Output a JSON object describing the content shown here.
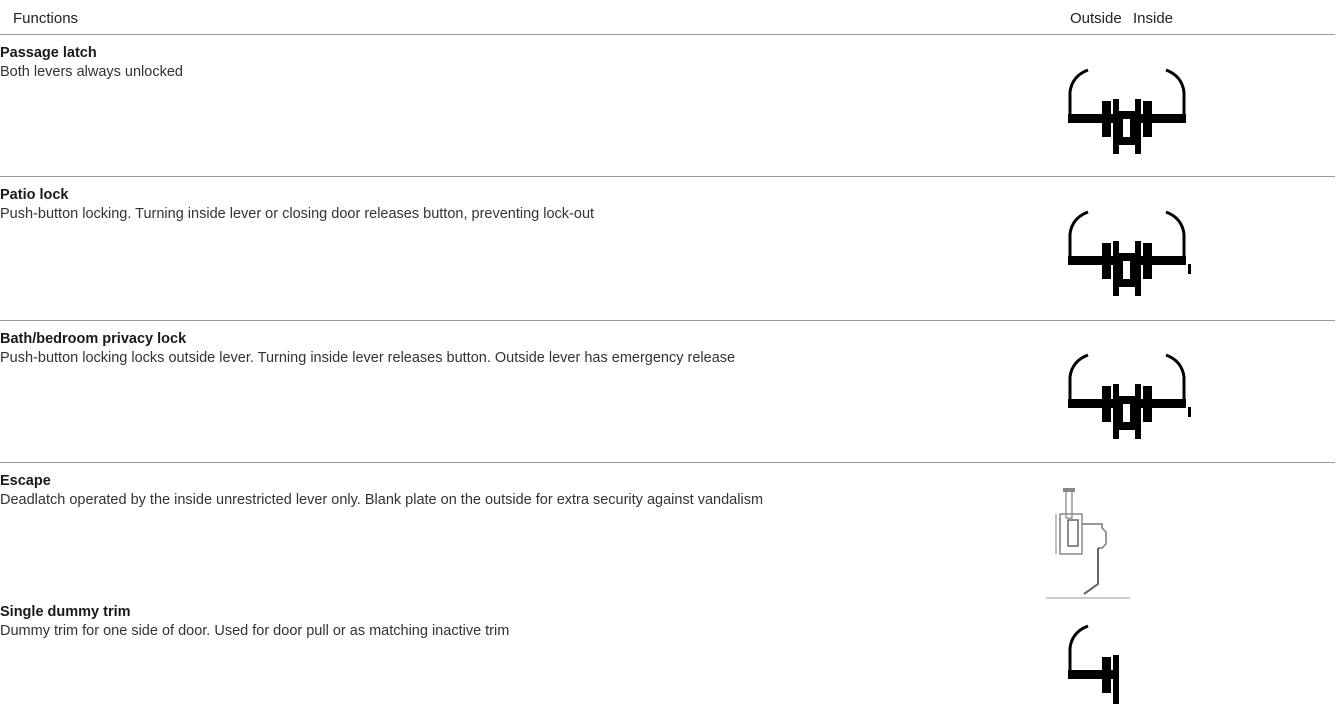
{
  "header": {
    "functions_label": "Functions",
    "outside_label": "Outside",
    "inside_label": "Inside"
  },
  "rows": [
    {
      "title": "Passage latch",
      "description": "Both levers always unlocked",
      "icon": "double-lever-icon"
    },
    {
      "title": "Patio lock",
      "description": "Push-button locking. Turning inside lever or closing door releases button, preventing lock-out",
      "icon": "double-lever-pushbutton-icon"
    },
    {
      "title": "Bath/bedroom privacy lock",
      "description": "Push-button locking locks outside lever. Turning inside lever releases button. Outside lever has emergency release",
      "icon": "double-lever-pushbutton-icon"
    },
    {
      "title": "Escape",
      "description": "Deadlatch operated by the inside unrestricted lever only. Blank plate on the outside for extra security against vandalism",
      "icon": "single-lever-sketch-icon"
    },
    {
      "title": "Single dummy trim",
      "description": "Dummy trim for one side of door. Used for door pull or as matching inactive trim",
      "icon": "single-lever-icon"
    }
  ]
}
